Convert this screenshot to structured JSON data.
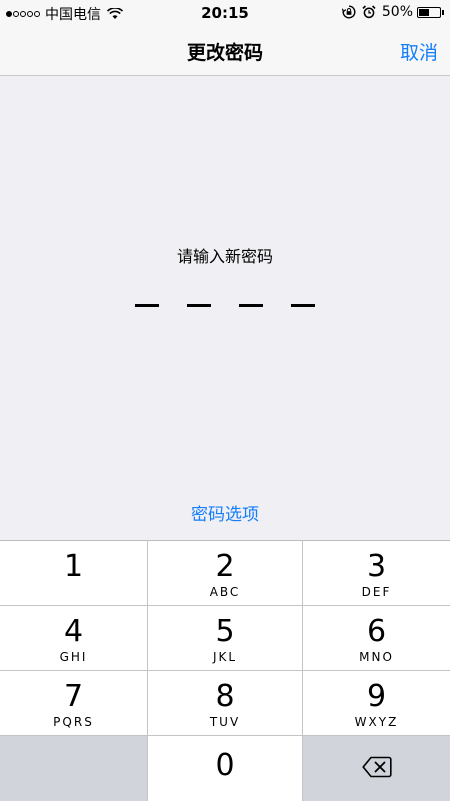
{
  "status_bar": {
    "carrier": "中国电信",
    "time": "20:15",
    "battery_percent": "50%",
    "battery_level": 0.5,
    "signal_bars_filled": 1,
    "signal_bars_total": 5
  },
  "nav": {
    "title": "更改密码",
    "cancel_label": "取消"
  },
  "main": {
    "prompt": "请输入新密码",
    "passcode_length": 4,
    "options_link": "密码选项"
  },
  "keypad": {
    "keys": [
      {
        "digit": "1",
        "letters": ""
      },
      {
        "digit": "2",
        "letters": "ABC"
      },
      {
        "digit": "3",
        "letters": "DEF"
      },
      {
        "digit": "4",
        "letters": "GHI"
      },
      {
        "digit": "5",
        "letters": "JKL"
      },
      {
        "digit": "6",
        "letters": "MNO"
      },
      {
        "digit": "7",
        "letters": "PQRS"
      },
      {
        "digit": "8",
        "letters": "TUV"
      },
      {
        "digit": "9",
        "letters": "WXYZ"
      },
      {
        "digit": "0",
        "letters": ""
      }
    ],
    "delete_icon": "backspace-icon"
  },
  "colors": {
    "accent": "#147efb",
    "background": "#efeff4",
    "bar": "#f7f7f7",
    "key_gray": "#d1d4da"
  }
}
